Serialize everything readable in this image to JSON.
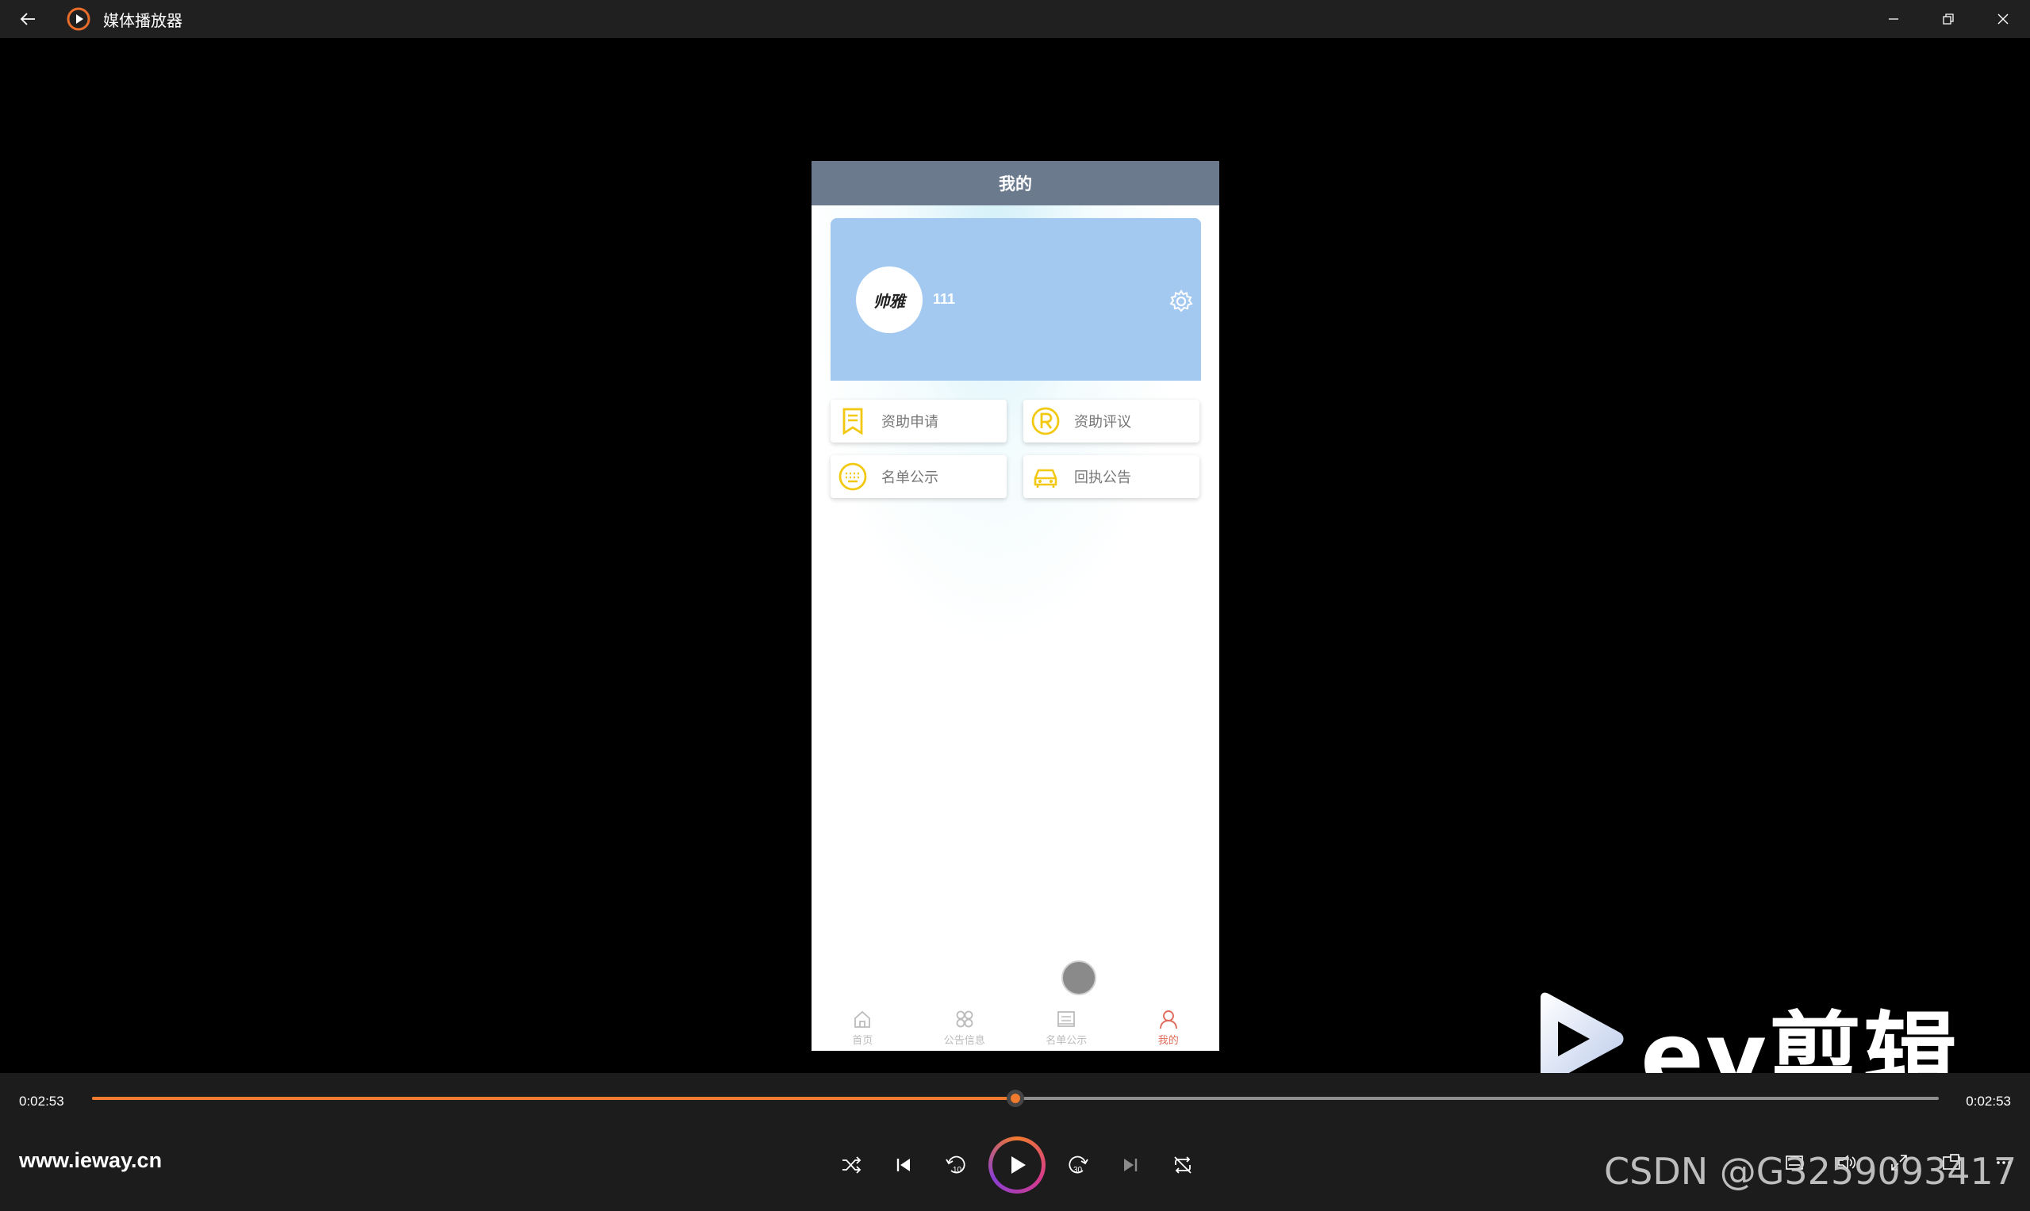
{
  "window": {
    "title": "媒体播放器",
    "minimize_icon": "minimize-icon",
    "restore_icon": "restore-icon",
    "close_icon": "close-icon"
  },
  "phone": {
    "header_title": "我的",
    "profile": {
      "avatar_text": "帅雅",
      "username": "111"
    },
    "menu": [
      {
        "label": "资助申请",
        "icon": "bookmark-icon"
      },
      {
        "label": "资助评议",
        "icon": "registered-icon"
      },
      {
        "label": "名单公示",
        "icon": "keyboard-icon"
      },
      {
        "label": "回执公告",
        "icon": "car-icon"
      }
    ],
    "tabs": [
      {
        "label": "首页",
        "icon": "home-icon",
        "active": false
      },
      {
        "label": "公告信息",
        "icon": "flower-icon",
        "active": false
      },
      {
        "label": "名单公示",
        "icon": "list-icon",
        "active": false
      },
      {
        "label": "我的",
        "icon": "user-icon",
        "active": true
      }
    ],
    "colors": {
      "header": "#6b7a8d",
      "card": "#a4c9f0",
      "icon_yellow": "#f2c811",
      "tab_active": "#e06b5a"
    }
  },
  "watermark": {
    "brand": "ev剪辑",
    "csdn": "CSDN @G3259093417"
  },
  "player": {
    "current_time": "0:02:53",
    "total_time": "0:02:53",
    "progress_fraction": 0.5,
    "site_label": "www.ieway.cn",
    "accent": "#f07a2e"
  }
}
